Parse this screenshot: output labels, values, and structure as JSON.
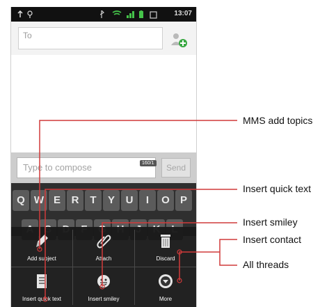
{
  "status_bar": {
    "time": "13:07"
  },
  "to_field": {
    "placeholder": "To"
  },
  "compose": {
    "placeholder": "Type to compose",
    "counter": "160/1",
    "send_label": "Send"
  },
  "keyboard": {
    "row1": [
      "Q",
      "W",
      "E",
      "R",
      "T",
      "Y",
      "U",
      "I",
      "O",
      "P"
    ],
    "row2": [
      "A",
      "S",
      "D",
      "F",
      "G",
      "H",
      "J",
      "K",
      "L"
    ]
  },
  "menu": {
    "items": [
      {
        "label": "Add subject",
        "icon": "paint-icon"
      },
      {
        "label": "Attach",
        "icon": "paperclip-icon"
      },
      {
        "label": "Discard",
        "icon": "trash-icon"
      },
      {
        "label": "Insert quick text",
        "icon": "document-icon"
      },
      {
        "label": "Insert smiley",
        "icon": "smiley-icon"
      },
      {
        "label": "More",
        "icon": "chevron-down-icon"
      }
    ]
  },
  "callouts": {
    "mms_add_topics": "MMS add topics",
    "insert_quick_text": "Insert quick text",
    "insert_smiley": "Insert smiley",
    "insert_contact": "Insert contact",
    "all_threads": "All threads"
  },
  "colors": {
    "callout_line": "#d13a3a",
    "accent_green": "#3aa843"
  }
}
